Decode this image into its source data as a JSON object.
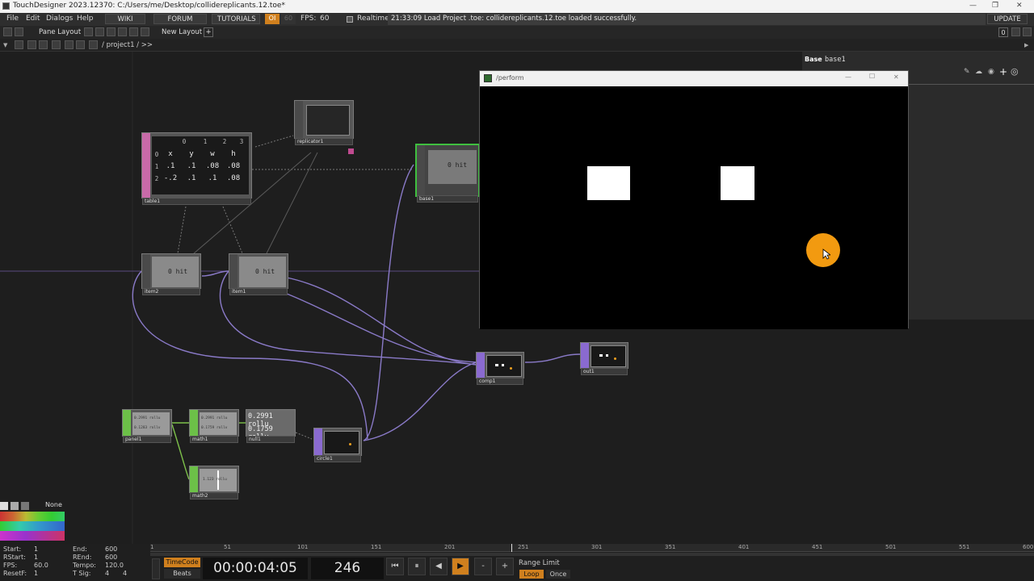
{
  "titlebar": {
    "title": "TouchDesigner 2023.12370: C:/Users/me/Desktop/collidereplicants.12.toe*",
    "minimize": "—",
    "maximize": "❐",
    "close": "✕"
  },
  "menubar": {
    "items": [
      "File",
      "Edit",
      "Dialogs",
      "Help"
    ],
    "wiki": "WIKI",
    "forum": "FORUM",
    "tutorials": "TUTORIALS",
    "oi": "OI",
    "sixty": "60",
    "fps_label": "FPS:",
    "fps_value": "60",
    "realtime": "Realtime",
    "log": "21:33:09 Load Project .toe: collidereplicants.12.toe loaded successfully.",
    "update": "UPDATE"
  },
  "layoutbar": {
    "pane_layout": "Pane Layout",
    "new_layout": "New Layout",
    "plus": "+",
    "zero": "0"
  },
  "pathbar": {
    "path": "/ project1 / >>"
  },
  "nodes": {
    "table1": {
      "label": "table1",
      "cols": [
        "0",
        "1",
        "2",
        "3"
      ],
      "rows": [
        {
          "idx": "0",
          "cells": [
            "x",
            "y",
            "w",
            "h"
          ]
        },
        {
          "idx": "1",
          "cells": [
            ".1",
            ".1",
            ".08",
            ".08"
          ]
        },
        {
          "idx": "2",
          "cells": [
            "-.2",
            ".1",
            ".1",
            ".08"
          ]
        }
      ]
    },
    "replicator1": {
      "label": "replicator1"
    },
    "base1": {
      "label": "base1",
      "text": "0 hit"
    },
    "item2": {
      "label": "item2",
      "text": "0 hit"
    },
    "item1": {
      "label": "item1",
      "text": "0 hit"
    },
    "comp1": {
      "label": "comp1"
    },
    "out1": {
      "label": "out1"
    },
    "circle1": {
      "label": "circle1"
    },
    "panel1": {
      "label": "panel1",
      "line1": "0.2991 rollu",
      "line2": "0.1283 rollv"
    },
    "math1": {
      "label": "math1",
      "line1": "0.2991 rollu",
      "line2": "0.1759 rollv"
    },
    "null1": {
      "label": "null1",
      "line1": "0.2991 rollu",
      "line2": "0.1759 rollv"
    },
    "math2": {
      "label": "math2",
      "line1": "1.123 rollu"
    }
  },
  "perform": {
    "title": "/perform",
    "minimize": "—",
    "maximize": "☐",
    "close": "✕"
  },
  "params": {
    "type": "Base",
    "name": "base1"
  },
  "palette": {
    "none_label": "None",
    "colors": [
      "#d9d9d9",
      "#b0b0b0",
      "#8a8a8a",
      "#5a5a5a",
      "#c33",
      "#c63",
      "#9a3",
      "#6b3",
      "#3b3",
      "#3c6",
      "#3a9",
      "#38a",
      "#c3c",
      "#a3c",
      "#63c",
      "#33c",
      "#3a3a",
      "#c36"
    ]
  },
  "timeline": {
    "ticks": [
      "1",
      "51",
      "101",
      "151",
      "201",
      "251",
      "301",
      "351",
      "401",
      "451",
      "501",
      "551",
      "600"
    ],
    "start_label": "Start:",
    "start": "1",
    "end_label": "End:",
    "end": "600",
    "rstart_label": "RStart:",
    "rstart": "1",
    "rend_label": "REnd:",
    "rend": "600",
    "fps_label": "FPS:",
    "fps": "60.0",
    "tempo_label": "Tempo:",
    "tempo": "120.0",
    "resetf_label": "ResetF:",
    "resetf": "1",
    "tsig_label": "T Sig:",
    "tsig_a": "4",
    "tsig_b": "4",
    "timecode": "TimeCode",
    "beats": "Beats",
    "time": "00:00:04:05",
    "frame": "246",
    "range_limit": "Range Limit",
    "loop": "Loop",
    "once": "Once",
    "minus": "-",
    "plus": "+"
  }
}
